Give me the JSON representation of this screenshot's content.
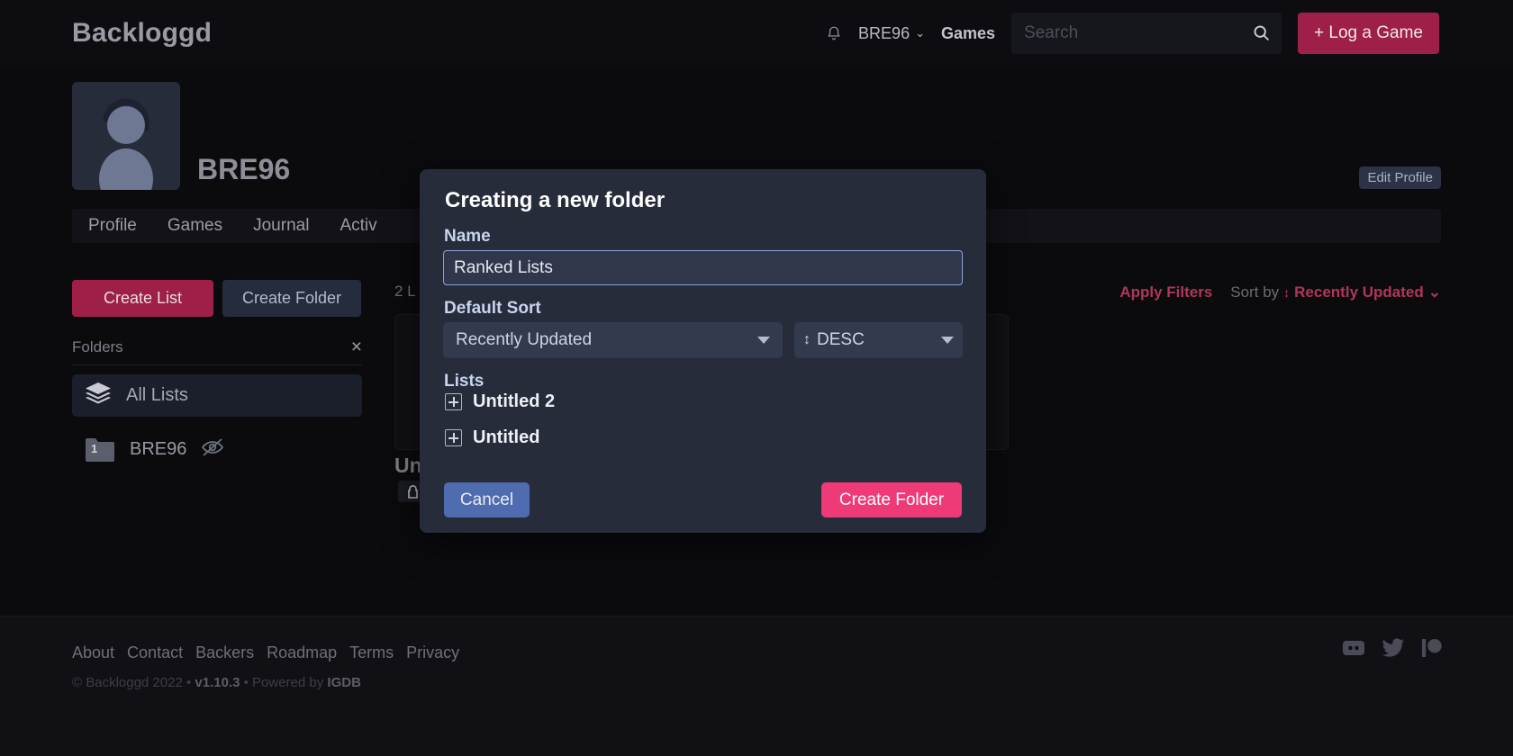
{
  "header": {
    "brand": "Backloggd",
    "bell_icon": "bell-icon",
    "username": "BRE96",
    "user_caret": "⌄",
    "games_link": "Games",
    "search_placeholder": "Search",
    "search_value": "",
    "search_icon": "search-icon",
    "log_game_button": "+ Log a Game"
  },
  "profile": {
    "avatar_icon": "default-avatar-icon",
    "username": "BRE96",
    "edit_profile": "Edit Profile",
    "tabs": [
      {
        "label": "Profile"
      },
      {
        "label": "Games"
      },
      {
        "label": "Journal"
      },
      {
        "label": "Activ"
      }
    ]
  },
  "sidebar": {
    "create_list": "Create List",
    "create_folder": "Create Folder",
    "section_label": "Folders",
    "close_icon": "×",
    "items": [
      {
        "label": "All Lists",
        "icon": "layers-icon",
        "active": true
      },
      {
        "label": "BRE96",
        "icon": "folder-icon",
        "badge": "1",
        "trailing_icon": "eye-off-icon",
        "active": false
      }
    ]
  },
  "main": {
    "list_count": "2 L",
    "apply_filters": "Apply Filters",
    "sort_by_label": "Sort by",
    "sort_updown_icon": "↕",
    "sort_value": "Recently Updated",
    "sort_caret": "⌄",
    "card_title": "Un",
    "lock_icon": "lock-icon"
  },
  "modal": {
    "title": "Creating a new folder",
    "name_label": "Name",
    "name_value": "Ranked Lists",
    "sort_label": "Default Sort",
    "sort_value": "Recently Updated",
    "direction_value": "DESC",
    "direction_icon": "↕",
    "lists_label": "Lists",
    "lists": [
      {
        "label": "Untitled 2",
        "icon": "plus-square-icon"
      },
      {
        "label": "Untitled",
        "icon": "plus-square-icon"
      }
    ],
    "cancel_button": "Cancel",
    "create_button": "Create Folder"
  },
  "footer": {
    "links": [
      {
        "label": "About"
      },
      {
        "label": "Contact"
      },
      {
        "label": "Backers"
      },
      {
        "label": "Roadmap"
      },
      {
        "label": "Terms"
      },
      {
        "label": "Privacy"
      }
    ],
    "copyright_prefix": "© Backloggd 2022 • ",
    "version": "v1.10.3",
    "copyright_middle": " • Powered by ",
    "igdb": "IGDB",
    "socials": [
      {
        "name": "discord-icon"
      },
      {
        "name": "twitter-icon"
      },
      {
        "name": "patreon-icon"
      }
    ]
  },
  "colors": {
    "accent_pink": "#ee3a77",
    "brand_crimson": "#9e1f47",
    "modal_bg": "#272c3a",
    "page_bg": "#0b0b0e"
  }
}
